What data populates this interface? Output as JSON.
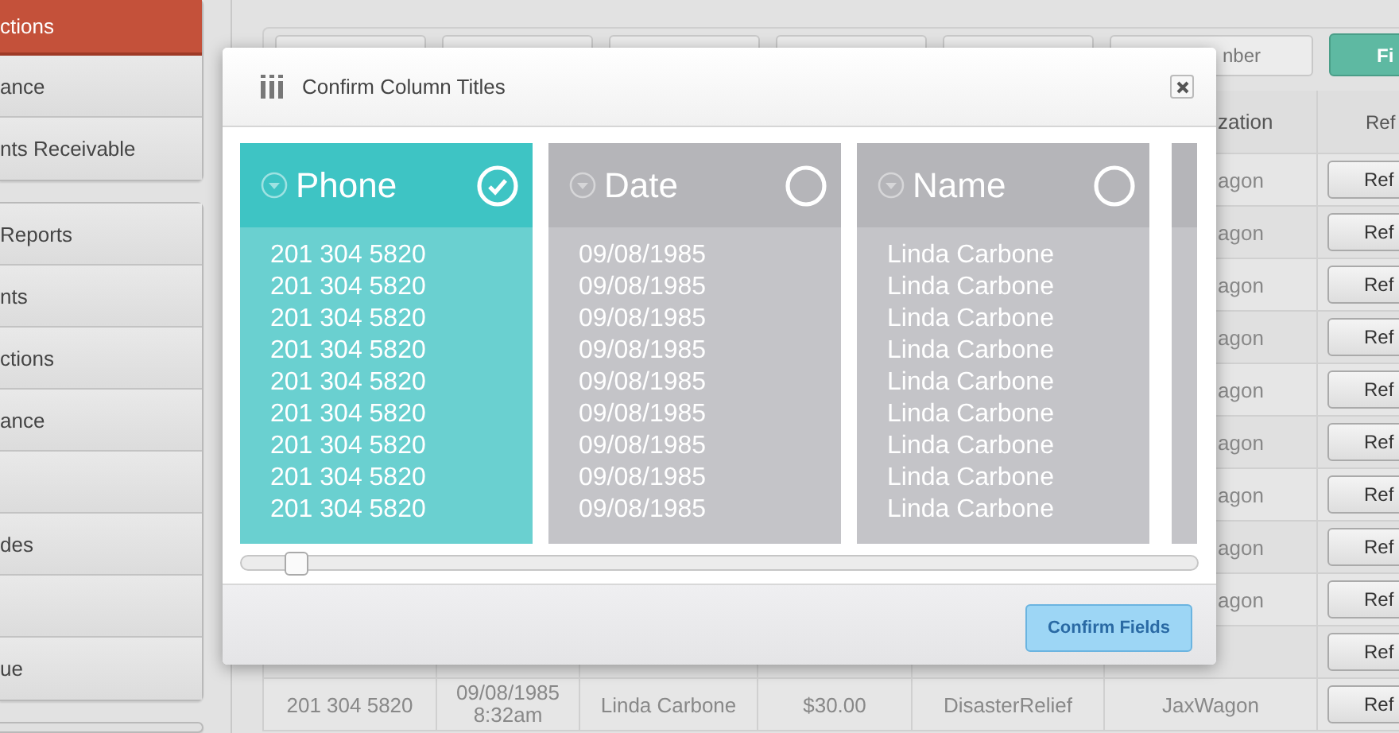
{
  "sidebar": {
    "groups": [
      {
        "items": [
          {
            "label": "ctions",
            "selected": true
          },
          {
            "label": "ance",
            "selected": false
          },
          {
            "label": "nts Receivable",
            "selected": false
          }
        ]
      },
      {
        "items": [
          {
            "label": "Reports",
            "selected": false
          },
          {
            "label": "nts",
            "selected": false
          },
          {
            "label": "ctions",
            "selected": false
          },
          {
            "label": "ance",
            "selected": false
          },
          {
            "selected": false
          },
          {
            "label": "des",
            "selected": false
          },
          {
            "selected": false
          },
          {
            "label": "ue",
            "selected": false
          }
        ]
      }
    ]
  },
  "filter_bar": {
    "field_placeholder": "nber",
    "button": "Fi"
  },
  "table": {
    "header": {
      "column_6": "zation",
      "column_7": "Ref"
    },
    "rows": [
      {
        "kind": "covered",
        "column_6": "agon",
        "column_7": "Ref"
      },
      {
        "kind": "covered",
        "column_6": "agon",
        "column_7": "Ref"
      },
      {
        "kind": "covered",
        "column_6": "agon",
        "column_7": "Ref"
      },
      {
        "kind": "covered",
        "column_6": "agon",
        "column_7": "Ref"
      },
      {
        "kind": "covered",
        "column_6": "agon",
        "column_7": "Ref"
      },
      {
        "kind": "covered",
        "column_6": "agon",
        "column_7": "Ref"
      },
      {
        "kind": "covered",
        "column_6": "agon",
        "column_7": "Ref"
      },
      {
        "kind": "covered",
        "column_6": "agon",
        "column_7": "Ref"
      },
      {
        "kind": "covered",
        "column_6": "agon",
        "column_7": "Ref"
      },
      {
        "kind": "covered",
        "column_7": "Ref"
      },
      {
        "kind": "full",
        "column_1": "201 304 5820",
        "column_2": "09/08/1985 8:32am",
        "column_3": "Linda Carbone",
        "column_4": "$30.00",
        "column_5": "DisasterRelief",
        "column_6": "JaxWagon",
        "column_7": "Ref"
      }
    ]
  },
  "dialog": {
    "title": "Confirm Column Titles",
    "columns": [
      {
        "title": "Phone",
        "selected": true,
        "values": [
          "201 304 5820",
          "201 304 5820",
          "201 304 5820",
          "201 304 5820",
          "201 304 5820",
          "201 304 5820",
          "201 304 5820",
          "201 304 5820",
          "201 304 5820"
        ]
      },
      {
        "title": "Date",
        "selected": false,
        "values": [
          "09/08/1985",
          "09/08/1985",
          "09/08/1985",
          "09/08/1985",
          "09/08/1985",
          "09/08/1985",
          "09/08/1985",
          "09/08/1985",
          "09/08/1985"
        ]
      },
      {
        "title": "Name",
        "selected": false,
        "values": [
          "Linda Carbone",
          "Linda Carbone",
          "Linda Carbone",
          "Linda Carbone",
          "Linda Carbone",
          "Linda Carbone",
          "Linda Carbone",
          "Linda Carbone",
          "Linda Carbone"
        ]
      }
    ],
    "confirm_button": "Confirm Fields"
  }
}
